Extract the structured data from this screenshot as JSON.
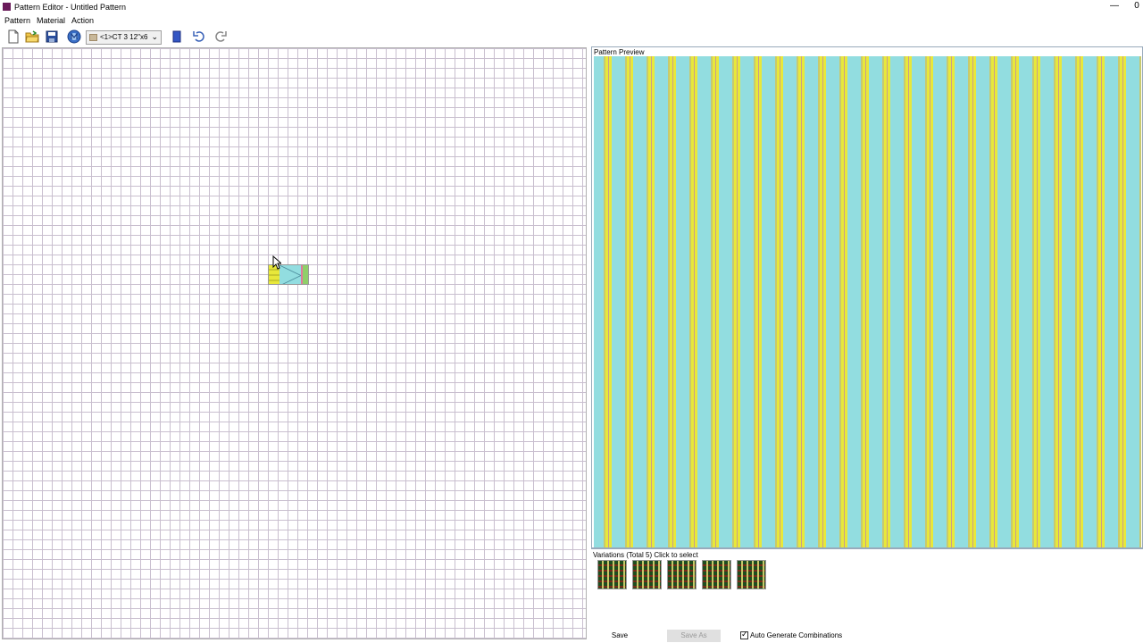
{
  "window": {
    "title": "Pattern Editor - Untitled Pattern",
    "minimize_glyph": "—",
    "extra_glyph": "0"
  },
  "menu": {
    "items": [
      "Pattern",
      "Material",
      "Action"
    ]
  },
  "toolbar": {
    "icons": [
      "new-file-icon",
      "open-folder-icon",
      "save-disk-icon",
      "material-globe-icon",
      "color-swatch-icon",
      "undo-icon",
      "redo-icon"
    ],
    "material_combo": {
      "value": "<1>CT 3 12\"x6",
      "arrow": "⌄"
    }
  },
  "preview": {
    "label": "Pattern Preview",
    "colors": {
      "aqua": "#92dde0",
      "yellow": "#e8e83a",
      "olive": "#c7c96f",
      "rose": "#c79f8c"
    }
  },
  "variations": {
    "label": "Variations (Total 5) Click to select",
    "count": 5
  },
  "bottom": {
    "save_label": "Save",
    "save_as_label": "Save As",
    "auto_generate_label": "Auto Generate Combinations",
    "auto_generate_checked": true,
    "check_mark": "✓"
  }
}
